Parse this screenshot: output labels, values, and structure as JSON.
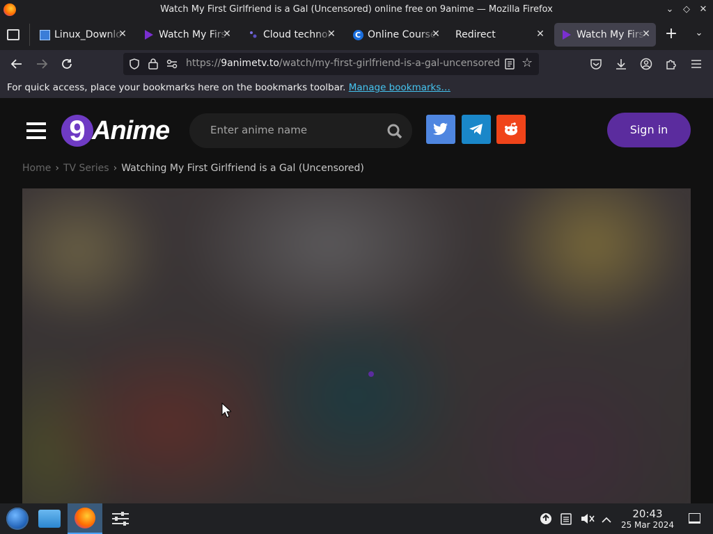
{
  "window": {
    "title": "Watch My First Girlfriend is a Gal (Uncensored) online free on 9anime — Mozilla Firefox"
  },
  "tabs": [
    {
      "label": "Linux_Downlo",
      "icon": "linux-download-favicon",
      "active": false
    },
    {
      "label": "Watch My First",
      "icon": "play-triangle-favicon",
      "active": false
    },
    {
      "label": "Cloud technol",
      "icon": "cloud-favicon",
      "active": false
    },
    {
      "label": "Online Courses",
      "icon": "c-circle-favicon",
      "active": false
    },
    {
      "label": "Redirect",
      "icon": "",
      "active": false
    },
    {
      "label": "Watch My First",
      "icon": "play-triangle-favicon",
      "active": true
    }
  ],
  "navbar": {
    "url_prefix": "https://",
    "url_domain": "9animetv.to",
    "url_path": "/watch/my-first-girlfriend-is-a-gal-uncensored"
  },
  "bookmarks": {
    "text": "For quick access, place your bookmarks here on the bookmarks toolbar.",
    "link": "Manage bookmarks…"
  },
  "site": {
    "logo_digit": "9",
    "logo_word": "Anime",
    "search_placeholder": "Enter anime name",
    "signin": "Sign in",
    "breadcrumb": [
      "Home",
      "TV Series",
      "Watching My First Girlfriend is a Gal (Uncensored)"
    ],
    "colors": {
      "accent": "#5b2c9e",
      "twitter": "#4f86e0",
      "telegram": "#1a87c9",
      "reddit": "#f0441a"
    }
  },
  "taskbar": {
    "time": "20:43",
    "date": "25 Mar 2024"
  }
}
